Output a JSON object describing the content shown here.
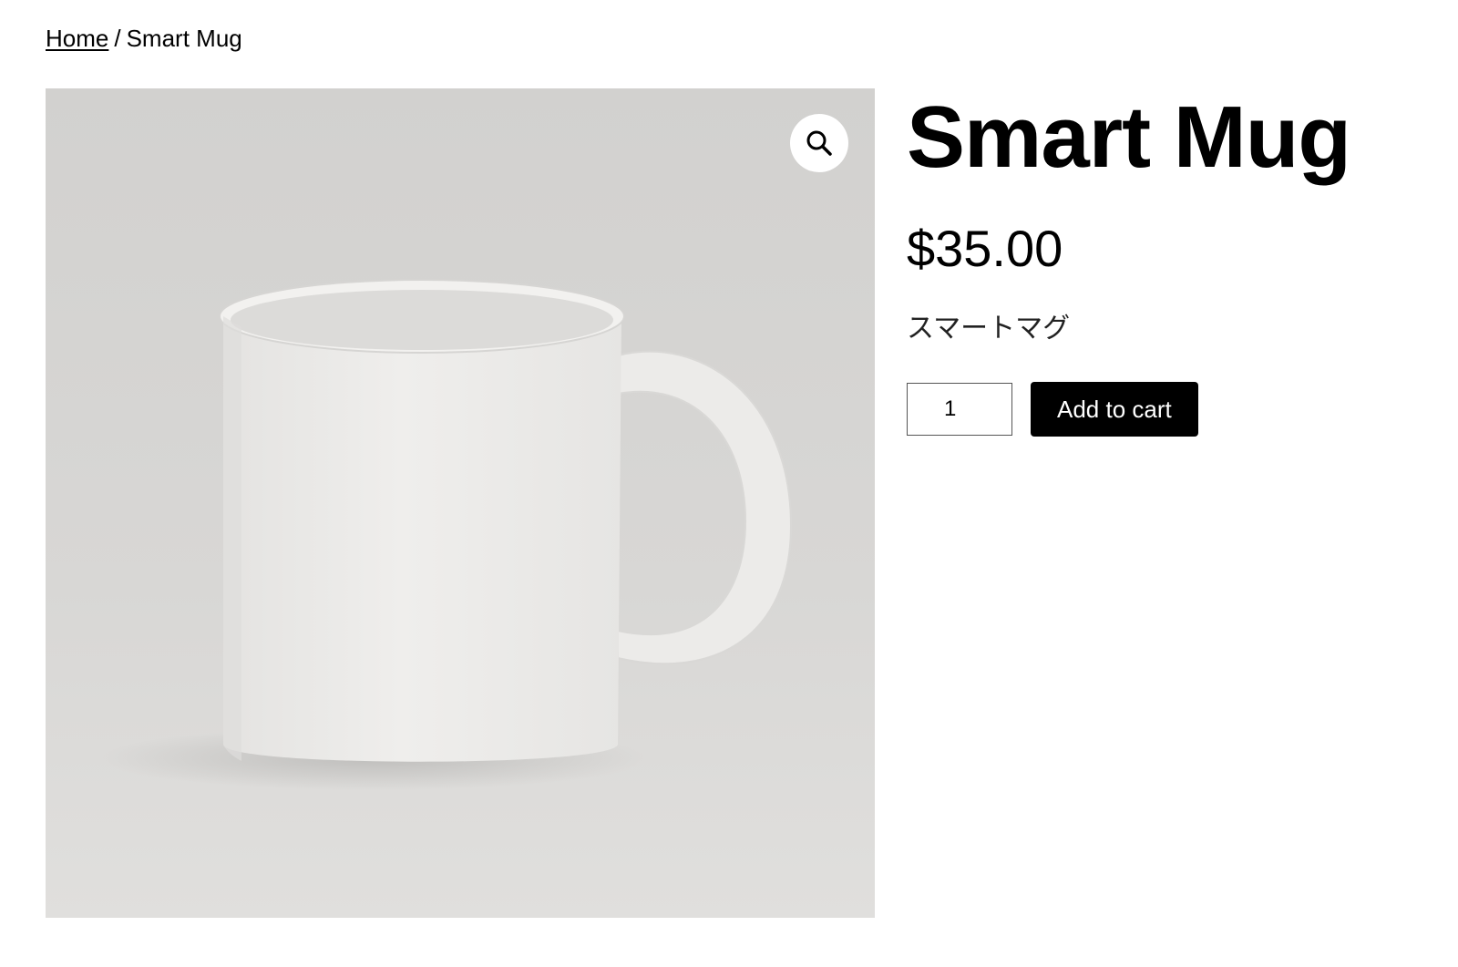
{
  "breadcrumb": {
    "home": "Home",
    "separator": "/",
    "current": "Smart Mug"
  },
  "product": {
    "title": "Smart Mug",
    "price": "$35.00",
    "description": "スマートマグ",
    "quantity": "1",
    "add_to_cart_label": "Add to cart",
    "image_alt": "White ceramic mug"
  },
  "icons": {
    "zoom": "magnifier-icon"
  },
  "colors": {
    "button_bg": "#000000",
    "button_text": "#ffffff",
    "image_bg": "#d4d3d1"
  }
}
